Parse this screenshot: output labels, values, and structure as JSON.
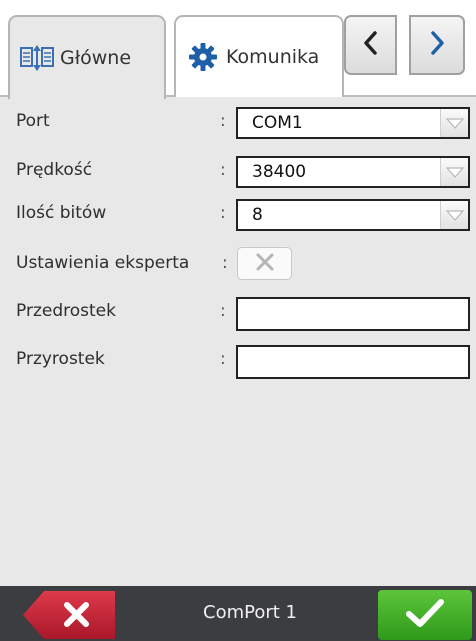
{
  "tabs": [
    {
      "label": "Główne",
      "icon": "columns-arrows-icon",
      "active": true
    },
    {
      "label": "Komunika",
      "icon": "gear-icon",
      "active": false
    }
  ],
  "nav": {
    "prev_icon": "chevron-left-icon",
    "next_icon": "chevron-right-icon"
  },
  "form": {
    "port": {
      "label": "Port",
      "colon": ":",
      "value": "COM1"
    },
    "speed": {
      "label": "Prędkość",
      "colon": ":",
      "value": "38400"
    },
    "bits": {
      "label": "Ilość bitów",
      "colon": ":",
      "value": "8"
    },
    "expert": {
      "label": "Ustawienia eksperta",
      "colon": ":",
      "checked": false
    },
    "prefix": {
      "label": "Przedrostek",
      "colon": ":",
      "value": ""
    },
    "suffix": {
      "label": "Przyrostek",
      "colon": ":",
      "value": ""
    }
  },
  "footer": {
    "title": "ComPort 1",
    "cancel_icon": "x-icon",
    "ok_icon": "checkmark-icon"
  },
  "colors": {
    "background": "#e8e8e8",
    "footer": "#3b3d40",
    "ok": "#3fae25",
    "cancel": "#c8283a",
    "nav_chevron": "#1f5fa8"
  }
}
